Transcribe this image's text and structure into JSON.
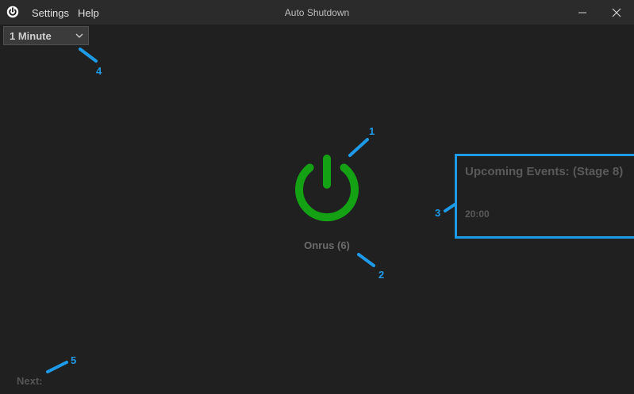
{
  "window": {
    "title": "Auto Shutdown",
    "menu": [
      "Settings",
      "Help"
    ]
  },
  "timer_dropdown": {
    "selected": "1 Minute"
  },
  "status": {
    "label": "Onrus (6)"
  },
  "events": {
    "title": "Upcoming Events: (Stage 8)",
    "times": [
      "20:00"
    ]
  },
  "footer": {
    "next_label": "Next:"
  },
  "annotations": [
    "1",
    "2",
    "3",
    "4",
    "5"
  ],
  "colors": {
    "background": "#202020",
    "titlebar": "#2b2b2b",
    "power_icon": "#14a114",
    "annotation": "#1e9be8"
  }
}
